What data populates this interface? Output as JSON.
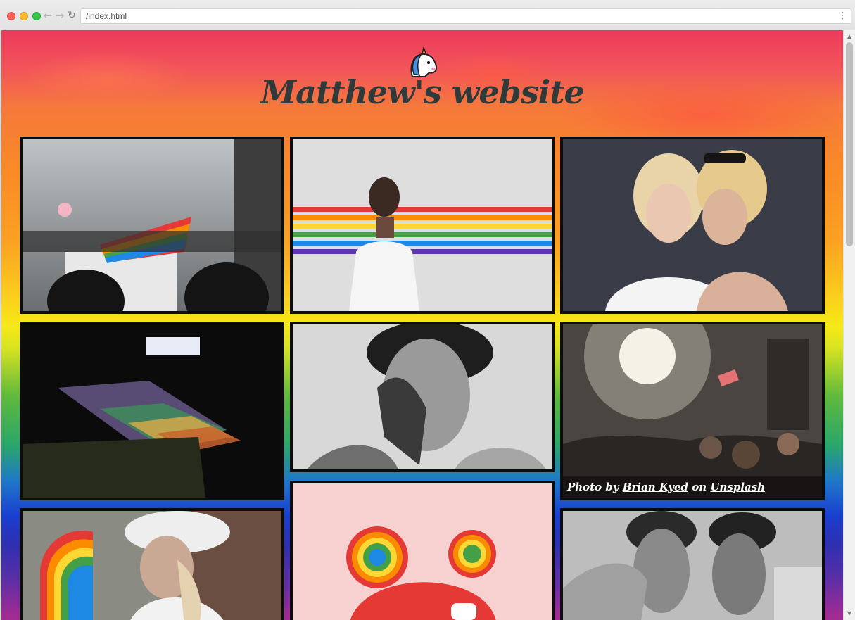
{
  "browser": {
    "url": "/index.html",
    "back_icon": "arrow-left-icon",
    "forward_icon": "arrow-right-icon",
    "reload_icon": "reload-icon",
    "menu_icon": "vertical-dots-icon"
  },
  "header": {
    "logo_icon": "unicorn-icon",
    "title": "Matthew's website"
  },
  "gallery": {
    "photos": [
      {
        "subject": "pride-parade-flag"
      },
      {
        "subject": "person-rainbow-stripes-wall"
      },
      {
        "subject": "two-women-portrait"
      },
      {
        "subject": "rainbow-flag-dark-room"
      },
      {
        "subject": "monochrome-portrait"
      },
      {
        "subject": "crowd-sunlight-flag"
      },
      {
        "subject": "person-rainbow-fan"
      },
      {
        "subject": "rainbow-mouse-ears-hat"
      },
      {
        "subject": "two-men-monochrome"
      }
    ],
    "caption": {
      "prefix": "Photo by",
      "author": "Brian Kyed",
      "middle": "on",
      "source": "Unsplash"
    }
  },
  "colors": {
    "title": "#2f3a3a",
    "frame": "#0c0c0c"
  }
}
